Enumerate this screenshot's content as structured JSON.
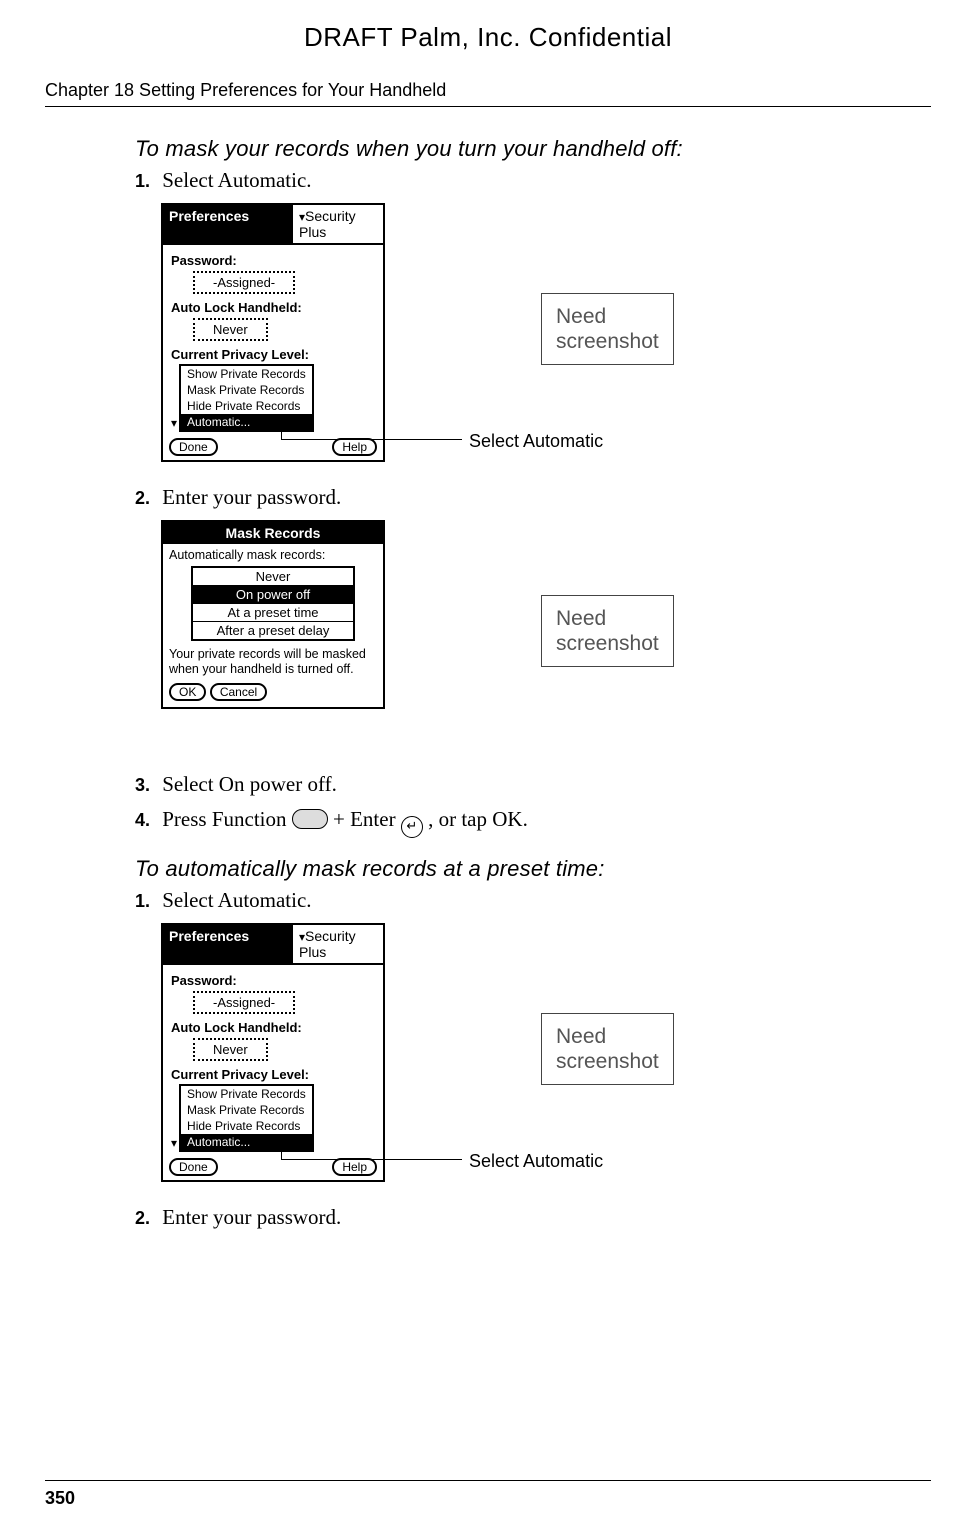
{
  "header": {
    "draft": "DRAFT   Palm, Inc. Confidential",
    "chapter": "Chapter 18   Setting Preferences for Your Handheld"
  },
  "section1": {
    "heading": "To mask your records when you turn your handheld off:",
    "step1_num": "1.",
    "step1_text": "Select Automatic.",
    "step2_num": "2.",
    "step2_text": "Enter your password.",
    "step3_num": "3.",
    "step3_text": "Select On power off.",
    "step4_num": "4.",
    "step4_pre": "Press Function ",
    "step4_mid": " + Enter ",
    "step4_post": " , or tap OK.",
    "enter_glyph": "↵"
  },
  "section2": {
    "heading": "To automatically mask records at a preset time:",
    "step1_num": "1.",
    "step1_text": "Select Automatic.",
    "step2_num": "2.",
    "step2_text": "Enter your password."
  },
  "prefs": {
    "title": "Preferences",
    "dropdown": "Security Plus",
    "password_label": "Password:",
    "password_value": "-Assigned-",
    "autolock_label": "Auto Lock Handheld:",
    "autolock_value": "Never",
    "privacy_label": "Current Privacy Level:",
    "menu": {
      "i1": "Show Private Records",
      "i2": "Mask Private Records",
      "i3": "Hide Private Records",
      "i4": "Automatic..."
    },
    "done": "Done",
    "help": "Help"
  },
  "maskdlg": {
    "title": "Mask Records",
    "prompt": "Automatically mask records:",
    "o1": "Never",
    "o2": "On power off",
    "o3": "At a preset time",
    "o4": "After a preset delay",
    "desc": "Your private records will be masked when your handheld is turned off.",
    "ok": "OK",
    "cancel": "Cancel"
  },
  "callouts": {
    "need": "Need\nscreenshot",
    "select_auto": "Select Automatic"
  },
  "footer": {
    "page": "350"
  }
}
